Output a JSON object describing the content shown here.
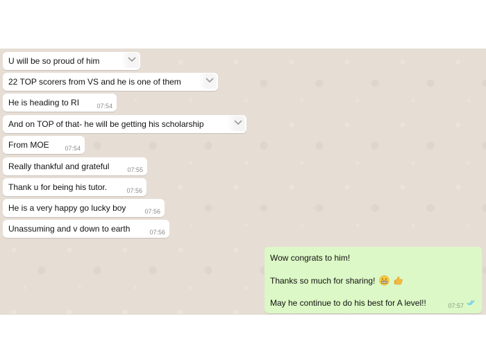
{
  "incoming": [
    {
      "text": "U will be so proud of him",
      "time": "",
      "chevron": true
    },
    {
      "text": "22 TOP scorers from VS and he is one of them",
      "time": "",
      "chevron": true
    },
    {
      "text": "He is heading to RI",
      "time": "07:54",
      "chevron": false
    },
    {
      "text": "And on TOP of that- he will be getting his scholarship",
      "time": "",
      "chevron": true
    },
    {
      "text": "From MOE",
      "time": "07:54",
      "chevron": false
    },
    {
      "text": "Really thankful and grateful",
      "time": "07:55",
      "chevron": false
    },
    {
      "text": "Thank u for being his tutor.",
      "time": "07:56",
      "chevron": false
    },
    {
      "text": "He is a very happy go lucky boy",
      "time": "07:56",
      "chevron": false
    },
    {
      "text": "Unassuming and v down to earth",
      "time": "07:56",
      "chevron": false
    }
  ],
  "outgoing": {
    "lines": [
      "Wow congrats to him!",
      "Thanks so much for sharing!",
      "May he continue to do his best for A level!!"
    ],
    "emojis": [
      "grimacing-face-icon",
      "thumbs-up-icon"
    ],
    "time": "07:57",
    "status": "read-double-tick-icon",
    "colors": {
      "bubble": "#dcf8c6",
      "ticks": "#4fc3f7"
    }
  },
  "colors": {
    "background": "#e6ded5",
    "incoming_bubble": "#ffffff"
  }
}
